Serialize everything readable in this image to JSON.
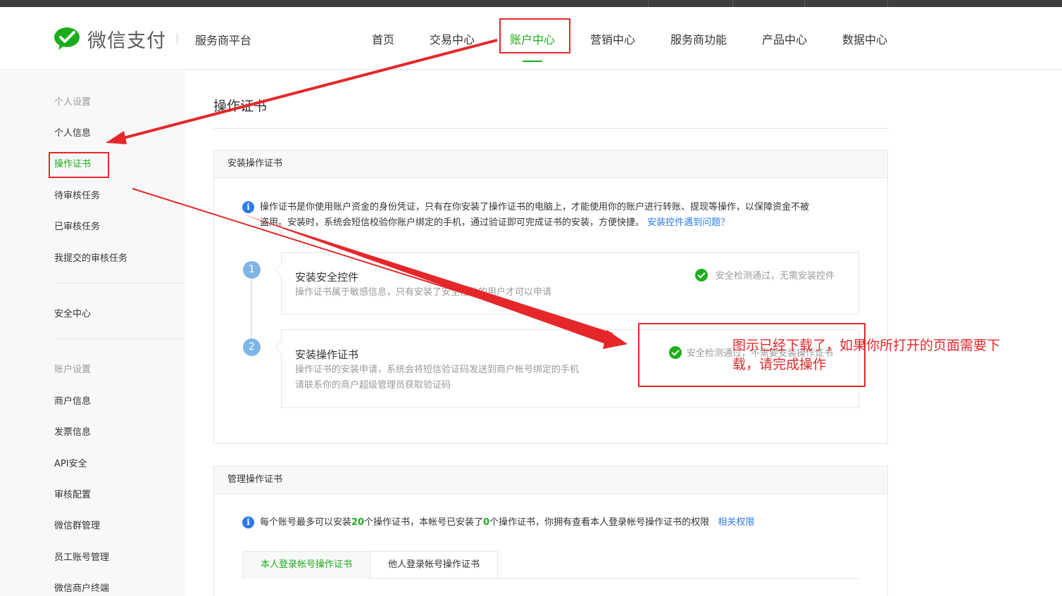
{
  "header": {
    "logo_text": "微信支付",
    "platform": "服务商平台",
    "nav": [
      {
        "label": "首页",
        "active": false
      },
      {
        "label": "交易中心",
        "active": false
      },
      {
        "label": "账户中心",
        "active": true
      },
      {
        "label": "营销中心",
        "active": false
      },
      {
        "label": "服务商功能",
        "active": false
      },
      {
        "label": "产品中心",
        "active": false
      },
      {
        "label": "数据中心",
        "active": false
      }
    ]
  },
  "sidebar": {
    "group_personal": "个人设置",
    "personal_items": [
      "个人信息",
      "操作证书",
      "待审核任务",
      "已审核任务",
      "我提交的审核任务"
    ],
    "security_center": "安全中心",
    "group_account": "账户设置",
    "account_items": [
      "商户信息",
      "发票信息",
      "API安全",
      "审核配置",
      "微信群管理",
      "员工账号管理",
      "微信商户终端"
    ]
  },
  "main": {
    "page_title": "操作证书",
    "install_panel": {
      "title": "安装操作证书",
      "notice_line1": "操作证书是你使用账户资金的身份凭证，只有在你安装了操作证书的电脑上，才能使用你的账户进行转账、提现等操作，以保障资金不被",
      "notice_line2": "盗用。安装时，系统会短信校验你账户绑定的手机，通过验证即可完成证书的安装，方便快捷。",
      "notice_link": "安装控件遇到问题？",
      "steps": [
        {
          "num": "1",
          "title": "安装安全控件",
          "desc1": "操作证书属于敏感信息，只有安装了安全控件的用户才可以申请",
          "desc2": "",
          "status": "安全检测通过，无需安装控件"
        },
        {
          "num": "2",
          "title": "安装操作证书",
          "desc1": "操作证书的安装申请，系统会将短信验证码发送到商户帐号绑定的手机",
          "desc2": "请联系你的商户超级管理员获取验证码",
          "status": "安全检测通过，不需要安装操作证书"
        }
      ]
    },
    "manage_panel": {
      "title": "管理操作证书",
      "notice_a": "每个账号最多可以安装",
      "max_count": "20",
      "notice_b": "个操作证书，本帐号已安装了",
      "installed_count": "0",
      "notice_c": "个操作证书，你拥有查看本人登录帐号操作证书的权限",
      "notice_link": "相关权限",
      "tabs": [
        "本人登录帐号操作证书",
        "他人登录帐号操作证书"
      ]
    }
  },
  "annotation": {
    "text": "图示已经下载了，如果你所打开的页面需要下载，请完成操作"
  },
  "colors": {
    "brand_green": "#1aad19",
    "link_blue": "#2b7ce9",
    "annotation_red": "#e5272a"
  }
}
